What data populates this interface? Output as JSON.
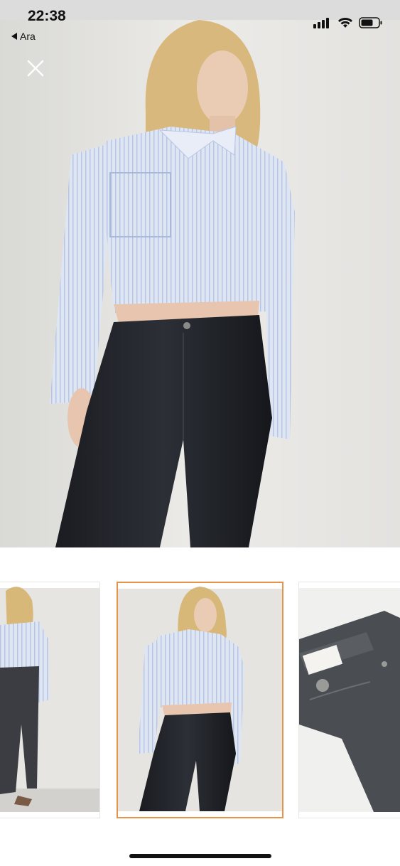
{
  "status_bar": {
    "time": "22:38",
    "back_label": "Ara",
    "icons": [
      "signal-icon",
      "wifi-icon",
      "battery-icon"
    ]
  },
  "viewer": {
    "close_icon": "close-icon",
    "main_image_alt": "",
    "thumbnails": [
      {
        "name": "back-view",
        "selected": false
      },
      {
        "name": "front-view",
        "selected": true
      },
      {
        "name": "detail-view",
        "selected": false
      }
    ]
  },
  "colors": {
    "selected_border": "#e8934a",
    "background": "#ffffff"
  }
}
